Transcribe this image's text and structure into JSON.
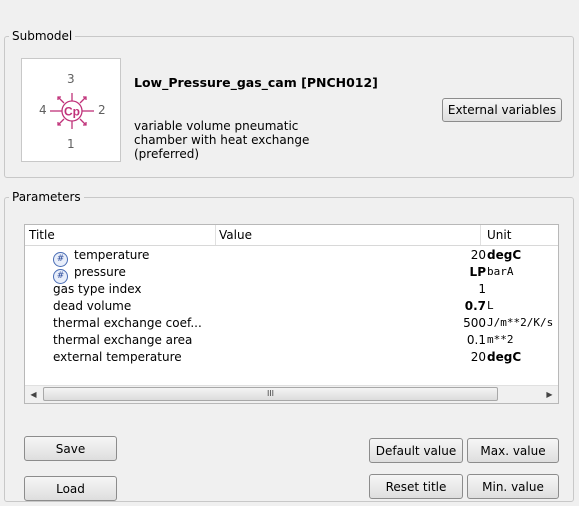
{
  "submodel": {
    "group_title": "Submodel",
    "name": "Low_Pressure_gas_cam [PNCH012]",
    "description": "variable volume pneumatic chamber with heat exchange (preferred)",
    "icon": {
      "symbol": "Cp",
      "ports": {
        "top": "3",
        "left": "4",
        "right": "2",
        "bottom": "1"
      },
      "color": "#c0327a"
    },
    "external_variables_label": "External variables"
  },
  "parameters": {
    "group_title": "Parameters",
    "columns": {
      "title": "Title",
      "value": "Value",
      "unit": "Unit"
    },
    "rows": [
      {
        "title": "temperature",
        "icon": "variable-icon",
        "value": "20",
        "value_bold": false,
        "unit": "degC",
        "unit_bold": true
      },
      {
        "title": "pressure",
        "icon": "variable-icon",
        "value": "LP",
        "value_bold": true,
        "unit": "barA",
        "unit_bold": false
      },
      {
        "title": "gas type index",
        "icon": "",
        "value": "1",
        "value_bold": false,
        "unit": "",
        "unit_bold": false
      },
      {
        "title": "dead volume",
        "icon": "",
        "value": "0.7",
        "value_bold": true,
        "unit": "L",
        "unit_bold": false
      },
      {
        "title": "thermal exchange coef...",
        "icon": "",
        "value": "500",
        "value_bold": false,
        "unit": "J/m**2/K/s",
        "unit_bold": false
      },
      {
        "title": "thermal exchange area",
        "icon": "",
        "value": "0.1",
        "value_bold": false,
        "unit": "m**2",
        "unit_bold": false
      },
      {
        "title": "external temperature",
        "icon": "",
        "value": "20",
        "value_bold": false,
        "unit": "degC",
        "unit_bold": true
      }
    ],
    "scroll_thumb_grip": "III"
  },
  "buttons": {
    "save": "Save",
    "load": "Load",
    "default_value": "Default value",
    "max_value": "Max. value",
    "reset_title": "Reset title",
    "min_value": "Min. value"
  }
}
